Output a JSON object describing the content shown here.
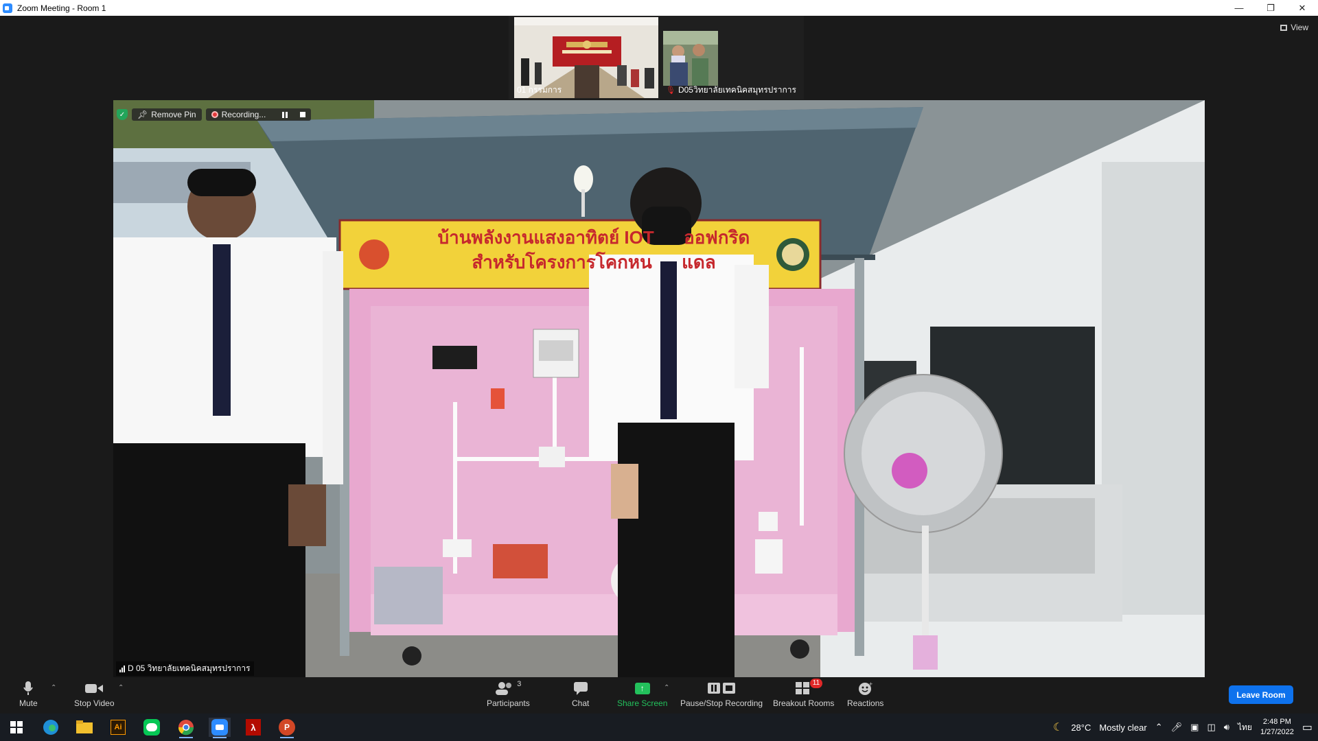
{
  "window": {
    "title": "Zoom Meeting - Room 1"
  },
  "gallery": {
    "participants": [
      {
        "name": "01 กรรมการ"
      },
      {
        "name": "D05วิทยาลัยเทคนิคสมุทรปราการ"
      }
    ],
    "view_label": "View"
  },
  "main_video": {
    "speaker_name": "D 05 วิทยาลัยเทคนิคสมุทรปราการ",
    "sign_line1": "บ้านพลังงานแสงอาทิตย์ IOT",
    "sign_line1b": "ออฟกริด",
    "sign_line2": "สำหรับโครงการโคกหน",
    "sign_line2b": "แดล"
  },
  "rec_bar": {
    "remove_pin_label": "Remove Pin",
    "recording_label": "Recording..."
  },
  "toolbar": {
    "mute_label": "Mute",
    "stop_video_label": "Stop Video",
    "participants_label": "Participants",
    "participants_count": "3",
    "chat_label": "Chat",
    "share_label": "Share Screen",
    "recording_label": "Pause/Stop Recording",
    "breakout_label": "Breakout Rooms",
    "breakout_badge": "11",
    "reactions_label": "Reactions",
    "leave_label": "Leave Room"
  },
  "taskbar": {
    "weather_temp": "28°C",
    "weather_text": "Mostly clear",
    "language": "ไทย",
    "time": "2:48 PM",
    "date": "1/27/2022"
  },
  "colors": {
    "accent_blue": "#0e72ed",
    "share_green": "#23c15c",
    "badge_red": "#e02828"
  }
}
